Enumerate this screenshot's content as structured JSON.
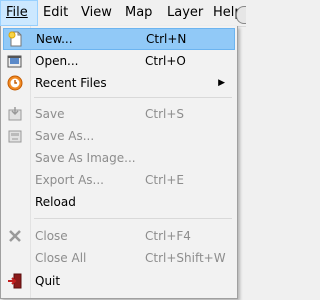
{
  "menubar": {
    "items": [
      {
        "label": "File"
      },
      {
        "label": "Edit"
      },
      {
        "label": "View"
      },
      {
        "label": "Map"
      },
      {
        "label": "Layer"
      },
      {
        "label": "Help"
      }
    ]
  },
  "file_menu": {
    "new": {
      "label": "New...",
      "shortcut": "Ctrl+N"
    },
    "open": {
      "label": "Open...",
      "shortcut": "Ctrl+O"
    },
    "recent": {
      "label": "Recent Files"
    },
    "save": {
      "label": "Save",
      "shortcut": "Ctrl+S"
    },
    "save_as": {
      "label": "Save As..."
    },
    "save_image": {
      "label": "Save As Image..."
    },
    "export": {
      "label": "Export As...",
      "shortcut": "Ctrl+E"
    },
    "reload": {
      "label": "Reload"
    },
    "close": {
      "label": "Close",
      "shortcut": "Ctrl+F4"
    },
    "close_all": {
      "label": "Close All",
      "shortcut": "Ctrl+Shift+W"
    },
    "quit": {
      "label": "Quit"
    }
  },
  "colors": {
    "highlight": "#91c9f7",
    "menubar_active": "#cce8ff",
    "disabled_text": "#8d8d8d"
  }
}
